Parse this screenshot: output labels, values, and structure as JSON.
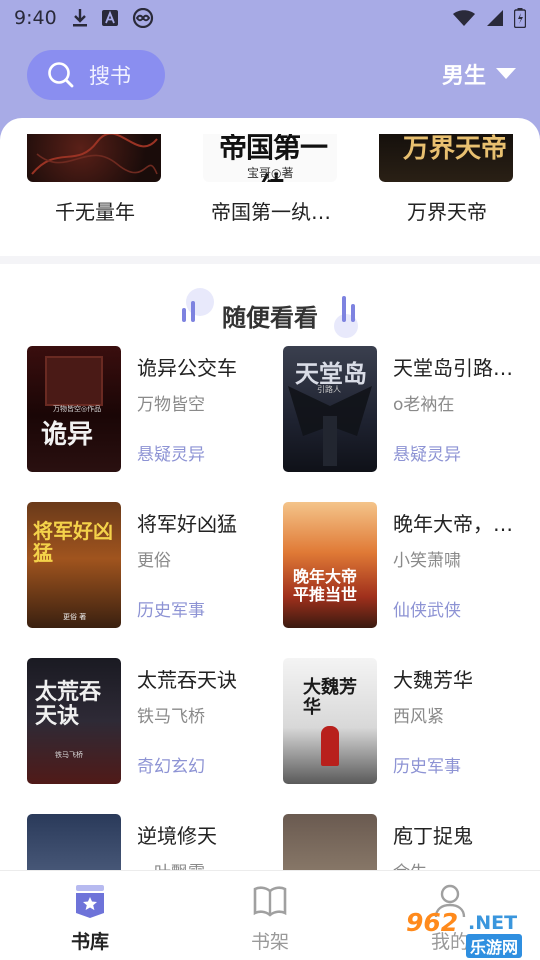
{
  "status_bar": {
    "time": "9:40"
  },
  "header": {
    "search_label": "搜书",
    "gender_label": "男生"
  },
  "top_shelf": [
    {
      "title": "千无量年"
    },
    {
      "title": "帝国第一纨…",
      "cover_author": "宝哥◎著"
    },
    {
      "title": "万界天帝"
    }
  ],
  "section": {
    "title": "随便看看"
  },
  "books": [
    {
      "title": "诡异公交车",
      "author": "万物皆空",
      "genre": "悬疑灵异",
      "cover_text": "诡异",
      "cover_sub": "万物皆空◎作品"
    },
    {
      "title": "天堂岛引路…",
      "author": "o老衲在",
      "genre": "悬疑灵异",
      "cover_text": "天堂岛",
      "cover_sub": "引路人"
    },
    {
      "title": "将军好凶猛",
      "author": "更俗",
      "genre": "历史军事",
      "cover_text": "将军好凶猛",
      "cover_sub": "更俗 著"
    },
    {
      "title": "晚年大帝，…",
      "author": "小笑萧啸",
      "genre": "仙侠武侠",
      "cover_text": "晚年大帝 平推当世",
      "cover_sub": ""
    },
    {
      "title": "太荒吞天诀",
      "author": "铁马飞桥",
      "genre": "奇幻玄幻",
      "cover_text": "太荒吞天诀",
      "cover_sub": "铁马飞桥"
    },
    {
      "title": "大魏芳华",
      "author": "西风紧",
      "genre": "历史军事",
      "cover_text": "大魏芳华",
      "cover_sub": ""
    },
    {
      "title": "逆境修天",
      "author": "一叶飘零",
      "genre": "",
      "cover_text": "",
      "cover_sub": ""
    },
    {
      "title": "庖丁捉鬼",
      "author": "余生一",
      "genre": "",
      "cover_text": "",
      "cover_sub": ""
    }
  ],
  "bottom_nav": [
    {
      "label": "书库",
      "active": true
    },
    {
      "label": "书架",
      "active": false
    },
    {
      "label": "我的",
      "active": false
    }
  ],
  "watermark": {
    "number": "962",
    "suffix": ".NET",
    "site": "乐游网"
  },
  "colors": {
    "header_bg": "#a8abe6",
    "search_pill": "#8a8ef0",
    "genre_text": "#8d93d4",
    "accent": "#7e83e0"
  }
}
